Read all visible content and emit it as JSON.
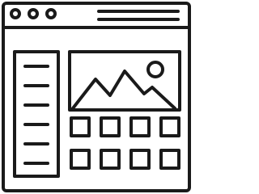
{
  "icon": {
    "subject": "website-layout-icon",
    "stroke_color": "#1a1a1a",
    "background_color": "#ffffff",
    "window_control_count": 3,
    "sidebar_line_count": 6,
    "gallery_grid": {
      "rows": 2,
      "columns": 4
    },
    "featured_image": {
      "depicts": "mountains-and-sun"
    }
  }
}
